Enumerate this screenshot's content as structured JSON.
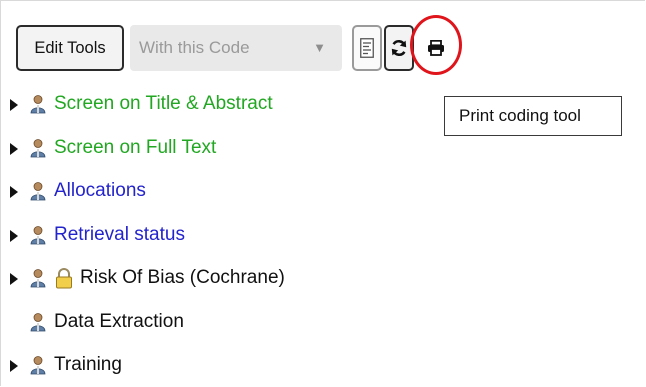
{
  "toolbar": {
    "edit_tools_label": "Edit Tools",
    "code_filter_value": "With this Code",
    "list_icon": "list-report-icon",
    "refresh_icon": "refresh-icon",
    "print_icon": "print-icon"
  },
  "tooltip": {
    "text": "Print coding tool"
  },
  "tree": {
    "items": [
      {
        "label": "Screen on Title & Abstract",
        "color": "#22a722",
        "expandable": true,
        "locked": false
      },
      {
        "label": "Screen on Full Text",
        "color": "#22a722",
        "expandable": true,
        "locked": false
      },
      {
        "label": "Allocations",
        "color": "#2424cc",
        "expandable": true,
        "locked": false
      },
      {
        "label": "Retrieval status",
        "color": "#2424cc",
        "expandable": true,
        "locked": false
      },
      {
        "label": "Risk Of Bias (Cochrane)",
        "color": "#111111",
        "expandable": true,
        "locked": true
      },
      {
        "label": "Data Extraction",
        "color": "#111111",
        "expandable": false,
        "locked": false
      },
      {
        "label": "Training",
        "color": "#111111",
        "expandable": true,
        "locked": false
      }
    ]
  },
  "highlight_color": "#e0141b"
}
